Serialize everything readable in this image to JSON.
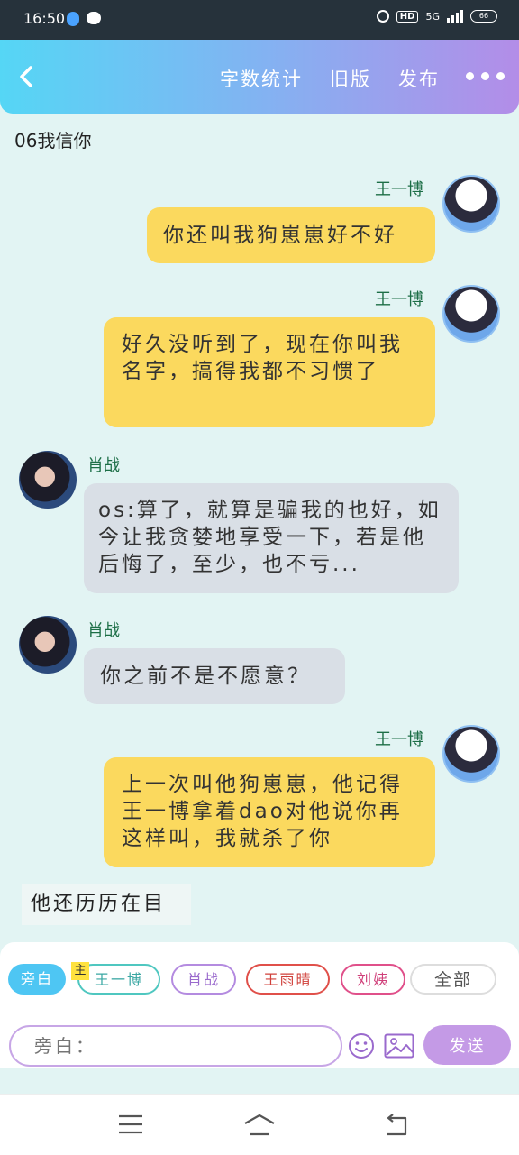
{
  "status_bar": {
    "time": "16:50",
    "hd": "HD",
    "network": "5G",
    "battery": "66"
  },
  "header": {
    "word_count": "字数统计",
    "old_version": "旧版",
    "publish": "发布"
  },
  "chapter_title": "06我信你",
  "messages": [
    {
      "speaker": "王一博",
      "text": "你还叫我狗崽崽好不好"
    },
    {
      "speaker": "王一博",
      "text": "好久没听到了，现在你叫我名字，搞得我都不习惯了"
    },
    {
      "speaker": "肖战",
      "text": "os:算了，就算是骗我的也好，如今让我贪婪地享受一下，若是他后悔了，至少，也不亏..."
    },
    {
      "speaker": "肖战",
      "text": "你之前不是不愿意？"
    },
    {
      "speaker": "王一博",
      "text": "上一次叫他狗崽崽，他记得王一博拿着dao对他说你再这样叫，我就杀了你"
    }
  ],
  "narration": "他还历历在目",
  "roles": {
    "narrator": "旁白",
    "main_tag": "主",
    "wyb": "王一博",
    "xz": "肖战",
    "wyq": "王雨晴",
    "liu": "刘姨",
    "all": "全部"
  },
  "input": {
    "placeholder": "旁白：",
    "send": "发送"
  },
  "colors": {
    "accent_purple": "#c49ae6",
    "bubble_yellow": "#fbd95e",
    "bubble_gray": "#d9dfe6",
    "name_green": "#1c6e46"
  }
}
